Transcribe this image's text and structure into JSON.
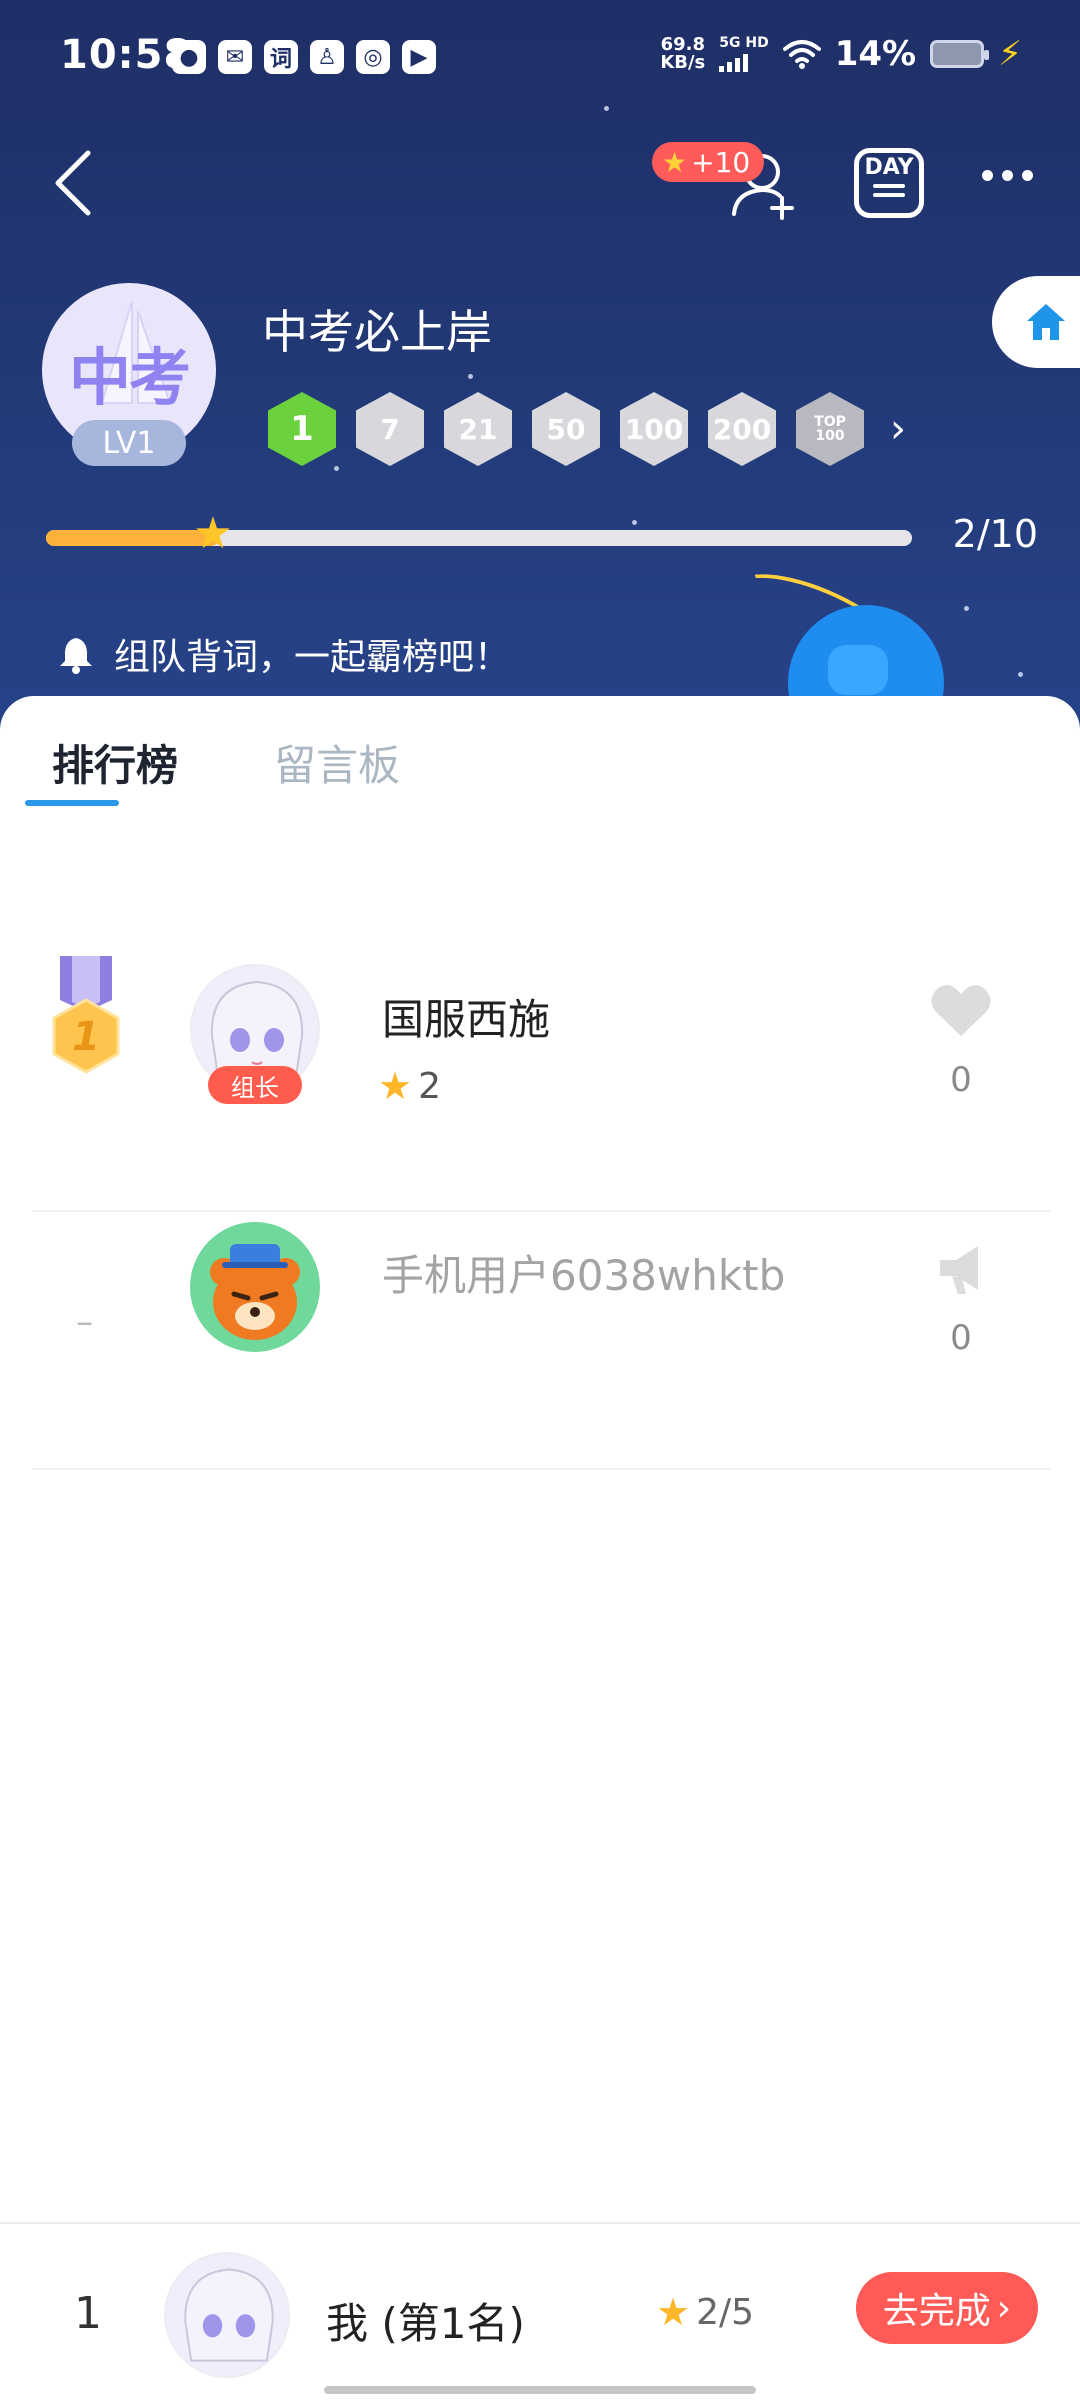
{
  "status_bar": {
    "time": "10:58",
    "net_speed_value": "69.8",
    "net_speed_unit": "KB/s",
    "network": "5G HD",
    "battery": "14%"
  },
  "header": {
    "reward": "+10",
    "day_label": "DAY",
    "group_avatar_text": "中考",
    "level": "LV1",
    "group_name": "中考必上岸",
    "badges": [
      "1",
      "7",
      "21",
      "50",
      "100",
      "200"
    ],
    "top_badge_line1": "TOP",
    "top_badge_line2": "100",
    "progress": {
      "value": 2,
      "max": 10,
      "label": "2/10"
    },
    "notice": "组队背词，一起霸榜吧！"
  },
  "tabs": [
    {
      "label": "排行榜",
      "active": true
    },
    {
      "label": "留言板",
      "active": false
    }
  ],
  "members": [
    {
      "rank": "1",
      "name": "国服西施",
      "tag": "组长",
      "score": "2",
      "likes": "0"
    },
    {
      "rank": "–",
      "name": "手机用户6038whktb",
      "likes": "0"
    }
  ],
  "me": {
    "rank": "1",
    "label": "我 (第1名)",
    "score": "2/5",
    "action": "去完成"
  },
  "colors": {
    "header_bg": "#223a78",
    "accent_blue": "#2a97e8",
    "progress": "#ffb23a",
    "active_badge": "#6bd23e",
    "cta_red": "#ff5a56"
  }
}
